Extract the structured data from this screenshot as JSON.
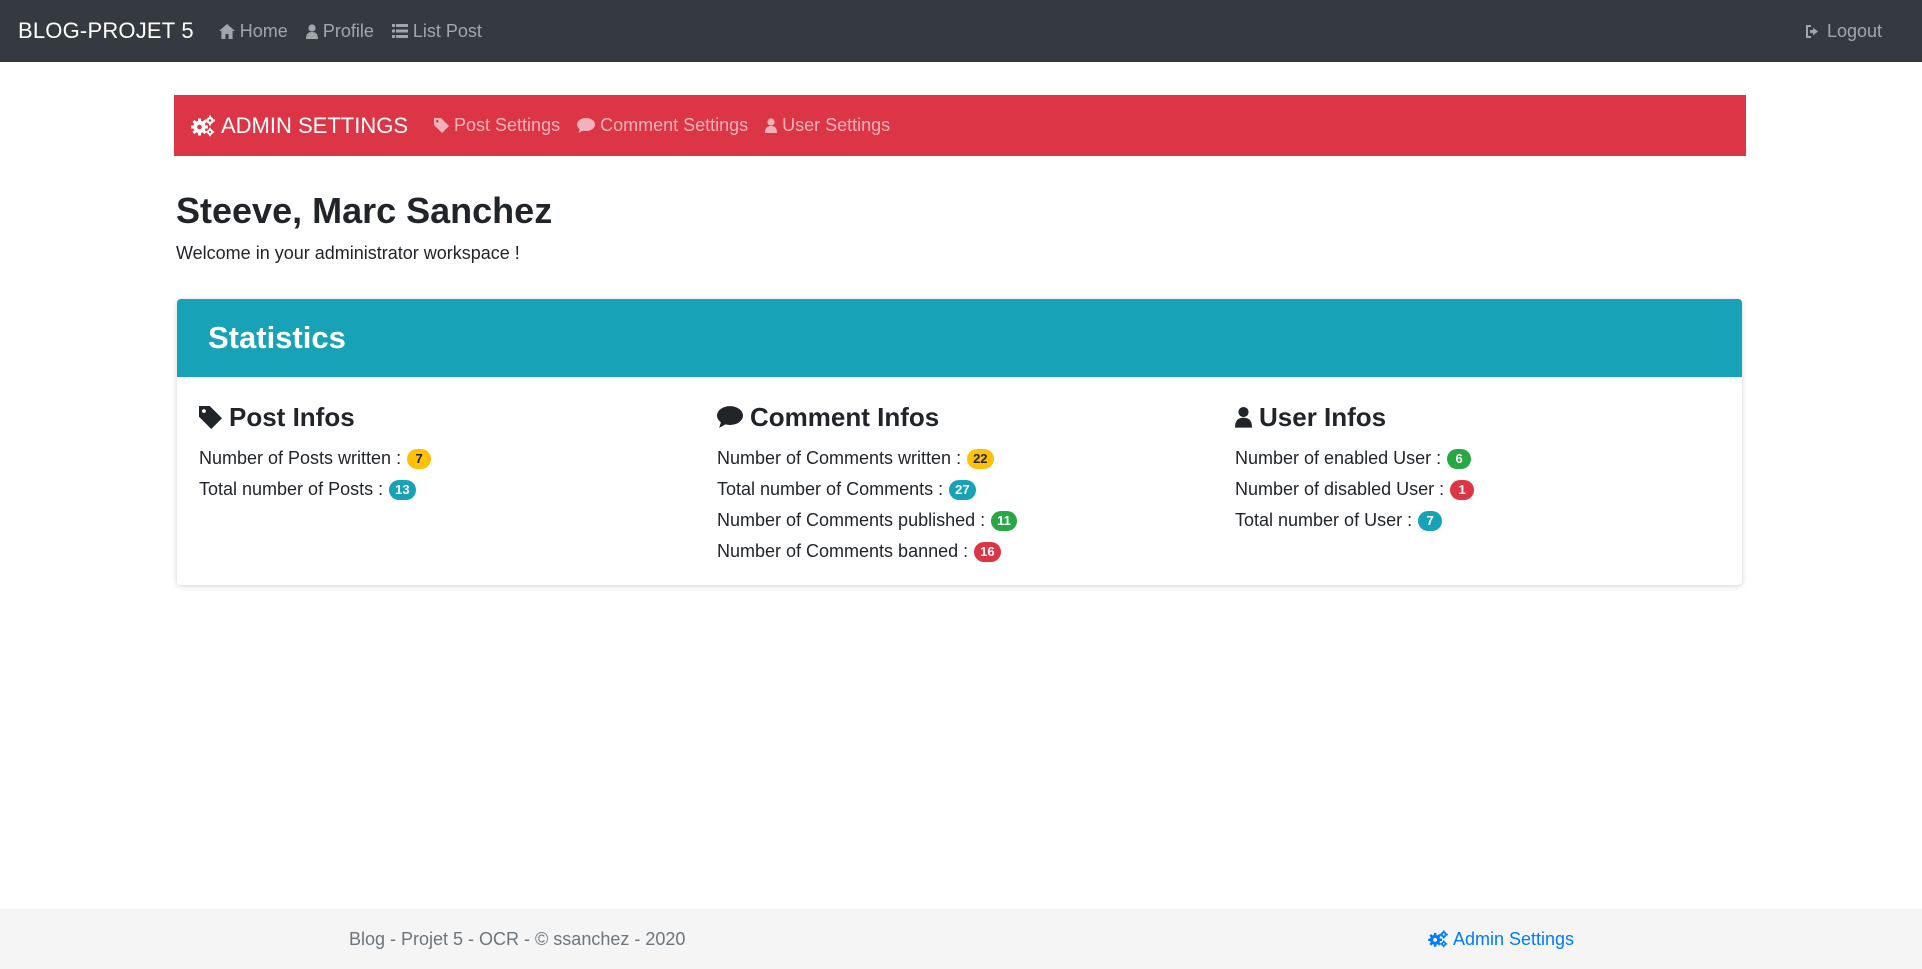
{
  "navbar": {
    "brand": "BLOG-PROJET 5",
    "links": [
      {
        "label": "Home",
        "icon": "home-icon"
      },
      {
        "label": "Profile",
        "icon": "user-icon"
      },
      {
        "label": "List Post",
        "icon": "list-icon"
      }
    ],
    "logout": {
      "label": "Logout",
      "icon": "sign-out-icon"
    }
  },
  "admin_nav": {
    "brand": "ADMIN SETTINGS",
    "brand_icon": "cogs-icon",
    "links": [
      {
        "label": "Post Settings",
        "icon": "tag-icon"
      },
      {
        "label": "Comment Settings",
        "icon": "comment-icon"
      },
      {
        "label": "User Settings",
        "icon": "user-icon"
      }
    ]
  },
  "page": {
    "title": "Steeve, Marc Sanchez",
    "subtitle": "Welcome in your administrator workspace !"
  },
  "statistics": {
    "title": "Statistics",
    "posts": {
      "title": "Post Infos",
      "icon": "tag-icon",
      "rows": [
        {
          "label": "Number of Posts written :",
          "value": "7"
        },
        {
          "label": "Total number of Posts :",
          "value": "13"
        }
      ]
    },
    "comments": {
      "title": "Comment Infos",
      "icon": "comment-icon",
      "rows": [
        {
          "label": "Number of Comments written :",
          "value": "22"
        },
        {
          "label": "Total number of Comments :",
          "value": "27"
        },
        {
          "label": "Number of Comments published :",
          "value": "11"
        },
        {
          "label": "Number of Comments banned :",
          "value": "16"
        }
      ]
    },
    "users": {
      "title": "User Infos",
      "icon": "user-icon",
      "rows": [
        {
          "label": "Number of enabled User :",
          "value": "6"
        },
        {
          "label": "Number of disabled User :",
          "value": "1"
        },
        {
          "label": "Total number of User :",
          "value": "7"
        }
      ]
    }
  },
  "footer": {
    "copyright": "Blog - Projet 5 - OCR - © ssanchez - 2020",
    "admin_link": "Admin Settings"
  },
  "colors": {
    "navbar": "#343a40",
    "admin_bar": "#dc3545",
    "card_header": "#17a2b8",
    "badge_warning": "#ffc107",
    "badge_info": "#17a2b8",
    "badge_success": "#28a745",
    "badge_danger": "#dc3545",
    "link": "#007bff"
  }
}
